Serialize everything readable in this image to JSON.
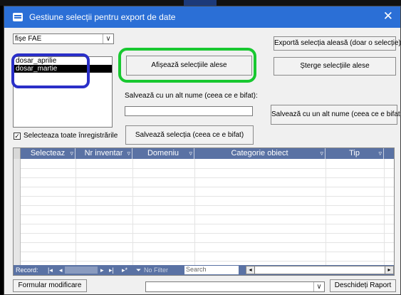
{
  "window": {
    "title": "Gestiune selecții pentru export de date",
    "close": "✕"
  },
  "filter_combo": {
    "value": "fișe FAE",
    "arrow": "∨"
  },
  "selections_list": {
    "items": [
      "dosar_aprilie",
      "dosar_martie"
    ],
    "selected_index": 1
  },
  "buttons": {
    "show_selected": "Afișează selecțiile alese",
    "export_selected": "Exportă selecția aleasă (doar o selecție)",
    "delete_selected": "Șterge selecțiile alese",
    "save_as_other": "Salvează cu un alt nume (ceea ce e bifat)",
    "save_selection": "Salvează selecția (ceea ce e bifat)",
    "edit_form": "Formular modificare",
    "open_report": "Deschideți Raport"
  },
  "save_as": {
    "label": "Salvează cu un alt nume (ceea ce e bifat):",
    "value": ""
  },
  "select_all": {
    "label": "Selecteaza toate înregistrările",
    "checked": true,
    "check_mark": "✓"
  },
  "grid": {
    "columns": [
      "Selecteaz",
      "Nr inventar",
      "Domeniu",
      "Categorie obiect",
      "Tip"
    ],
    "dropdown_glyph": "▿"
  },
  "navbar": {
    "record_label": "Record:",
    "first": "|◂",
    "prev": "◂",
    "next": "▸",
    "last": "▸|",
    "new": "▸*",
    "filter_icon": "⏷",
    "filter": "No Filter",
    "search": "Search",
    "scroll_left": "◂",
    "scroll_right": "▸"
  },
  "report_combo": {
    "value": "",
    "arrow": "∨"
  },
  "colors": {
    "titlebar": "#2b6fd6",
    "grid_header": "#5a72a4",
    "annotation_blue": "#2a2fc8",
    "annotation_green": "#18c830"
  }
}
